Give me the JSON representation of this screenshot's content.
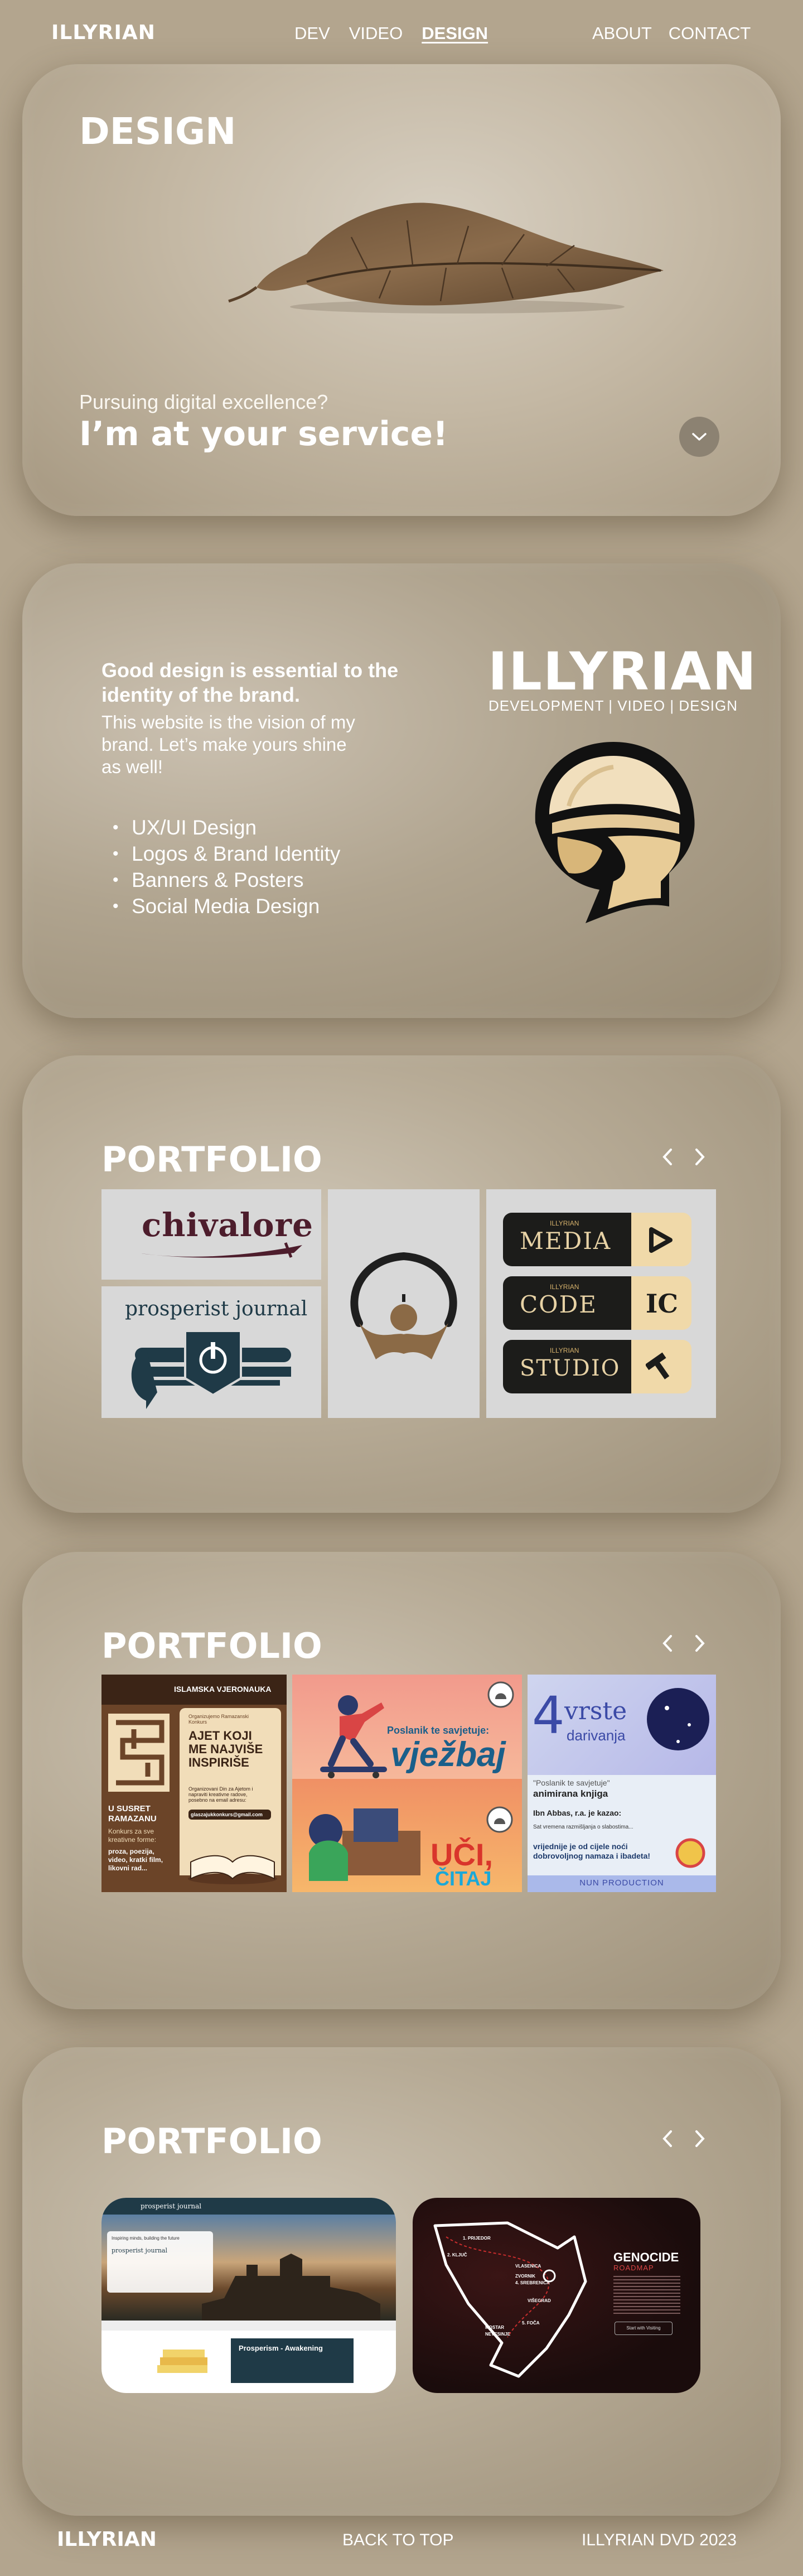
{
  "header": {
    "logo": "ILLYRIAN",
    "nav_center": [
      "DEV",
      "VIDEO",
      "DESIGN"
    ],
    "nav_right": [
      "ABOUT",
      "CONTACT"
    ],
    "active": "DESIGN"
  },
  "hero": {
    "title": "DESIGN",
    "subtitle": "Pursuing digital excellence?",
    "headline": "I’m at your service!",
    "scroll_icon": "chevron-down-icon"
  },
  "about": {
    "heading": "Good design is essential to the identity of the brand.",
    "text": "This website is the vision of my brand. Let’s make yours shine as well!",
    "skills": [
      "UX/UI Design",
      "Logos & Brand Identity",
      "Banners & Posters",
      "Social Media Design"
    ],
    "brand_name": "ILLYRIAN",
    "brand_tagline": "DEVELOPMENT | VIDEO | DESIGN"
  },
  "portfolio_logos": {
    "title": "PORTFOLIO",
    "items": {
      "chivalore": "chivalore",
      "prosperist": "prosperist journal",
      "media_small": "ILLYRIAN",
      "media": "MEDIA",
      "code_small": "ILLYRIAN",
      "code": "CODE",
      "code_mark": "IC",
      "studio_small": "ILLYRIAN",
      "studio": "STUDIO"
    }
  },
  "portfolio_posters": {
    "title": "PORTFOLIO",
    "poster1": {
      "header": "ISLAMSKA VJERONAUKA",
      "org": "Organizujemo Ramazanski Konkurs",
      "big": "AJET KOJI ME NAJVIŠE INSPIRIŠE",
      "info": "Organizovani Din za Ajetom i napraviti kreativne radove, posebno na email adresu:",
      "email": "glaszajukkonkurs@gmail.com",
      "side1": "U SUSRET RAMAZANU",
      "side2": "Konkurs za sve kreativne forme:",
      "side3": "proza, poezija, video, kratki film, likovni rad..."
    },
    "poster2": {
      "line1": "Poslanik te savjetuje:",
      "line2": "vježbaj",
      "line3": "UČI,",
      "line4": "ČITAJ"
    },
    "poster3": {
      "top_num": "4",
      "top_word": "vrste",
      "top_word2": "darivanja",
      "mid1": "\"Poslanik te savjetuje\"",
      "mid2": "animirana knjiga",
      "quote_src": "Ibn Abbas, r.a. je kazao:",
      "quote1": "Sat vremena razmišljanja o slabostima...",
      "quote2": "vrijednije je od cijele noći dobrovoljnog namaza i ibadeta!",
      "footer": "NUN PRODUCTION"
    }
  },
  "portfolio_web": {
    "title": "PORTFOLIO",
    "site1": {
      "brand": "prosperist journal",
      "tagline": "Inspiring minds, building the future",
      "section": "Prosperism - Awakening"
    },
    "site2": {
      "brand": "GENOCIDE",
      "brand_sub": "ROADMAP",
      "places": [
        "1. PRIJEDOR",
        "2. KLJUČ",
        "3. CAZIN",
        "VLASENICA",
        "ZVORNIK",
        "4. SREBRENICA",
        "VIŠEGRAD",
        "5. FOČA",
        "MOSTAR",
        "NEVESINJE"
      ],
      "button": "Start with Visiting"
    }
  },
  "footer": {
    "logo": "ILLYRIAN",
    "back_to_top": "BACK TO TOP",
    "copyright": "ILLYRIAN DVD 2023"
  },
  "colors": {
    "page_bg": "#b3a58e",
    "dark_tile": "#1c1c1a",
    "accent_gold": "#d4b06b"
  }
}
